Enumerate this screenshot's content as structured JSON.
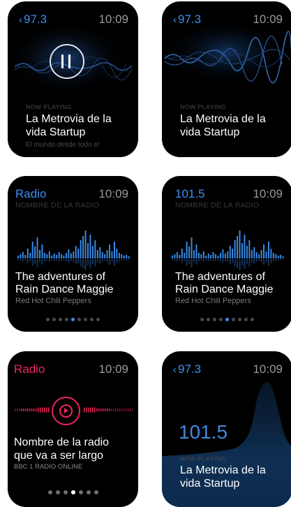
{
  "screens": [
    {
      "back_label": "97.3",
      "time": "10:09",
      "now_playing": "NOW PLAYING",
      "title_line1": "La Metrovia de la",
      "title_line2": "vida Startup",
      "description": "El mundo desde todo el"
    },
    {
      "back_label": "97.3",
      "time": "10:09",
      "now_playing": "NOW PLAYING",
      "title_line1": "La Metrovia de la",
      "title_line2": "vida Startup"
    },
    {
      "station": "Radio",
      "time": "10:09",
      "subtitle": "NOMBRE DE LA RADIO",
      "title_line1": "The adventures of",
      "title_line2": "Rain Dance Maggie",
      "artist": "Red Hot Chili Peppers",
      "page_count": 9,
      "active_page": 5
    },
    {
      "station": "101.5",
      "time": "10:09",
      "subtitle": "NOMBRE DE LA RADIO",
      "title_line1": "The adventures of",
      "title_line2": "Rain Dance Maggie",
      "artist": "Red Hot Chili Peppers",
      "page_count": 9,
      "active_page": 5
    },
    {
      "station": "Radio",
      "time": "10:09",
      "title_line1": "Nombre de la radio",
      "title_line2": "que va a ser largo",
      "subtitle": "BBC 1 RADIO ONLINE",
      "page_count": 7,
      "active_page": 4
    },
    {
      "back_label": "97.3",
      "time": "10:09",
      "frequency": "101.5",
      "now_playing": "NOW PLAYING",
      "title_line1": "La Metrovia de la",
      "title_line2": "vida Startup"
    }
  ],
  "colors": {
    "accent_blue": "#3b8ff0",
    "accent_pink": "#f0245e",
    "background": "#000000"
  },
  "icons": {
    "back": "chevron-left-icon",
    "pause": "pause-icon",
    "play": "play-icon"
  }
}
